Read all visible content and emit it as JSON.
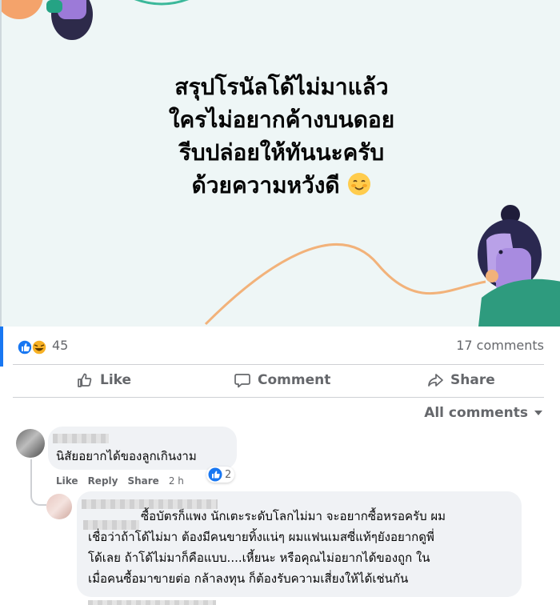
{
  "post": {
    "headline": [
      "สรุปโรนัลโด้ไม่มาแล้ว",
      "ใครไม่อยากค้างบนดอย",
      "รีบปล่อยให้ทันนะครับ",
      "ด้วยความหวังดี"
    ],
    "headline_emoji": "smiling-blush-emoji"
  },
  "stats": {
    "reaction_count": "45",
    "reaction_icons": [
      "like-reaction-icon",
      "haha-reaction-icon"
    ],
    "comment_count": "17 comments"
  },
  "actions": {
    "like": "Like",
    "comment": "Comment",
    "share": "Share"
  },
  "filter": {
    "label": "All comments"
  },
  "comments": [
    {
      "text": "นิสัยอยากได้ของลูกเกินงาม",
      "like": "Like",
      "reply": "Reply",
      "share": "Share",
      "time": "2 h",
      "reactions": "2"
    },
    {
      "lines": [
        "ซื้อบัตรก็แพง นักเตะระดับโลกไม่มา จะอยากซื้อหรอครับ ผม",
        "เชื่อว่าถ้าโด้ไม่มา ต้องมีคนขายทิ้งแน่ๆ ผมแฟนเมสซี่แท้ๆยังอยากดูพี่",
        "โด้เลย ถ้าโด้ไม่มาก็คือแบบ....เหี้ยนะ หรือคุณไม่อยากได้ของถูก ใน",
        "เมื่อคนซื้อมาขายต่อ กล้าลงทุน ก็ต้องรับความเสี่ยงให้ได้เช่นกัน"
      ]
    }
  ],
  "colors": {
    "accent": "#1877f2",
    "image_bg": "#eef6f6",
    "bubble": "#f0f2f5",
    "muted_text": "#65676b"
  }
}
